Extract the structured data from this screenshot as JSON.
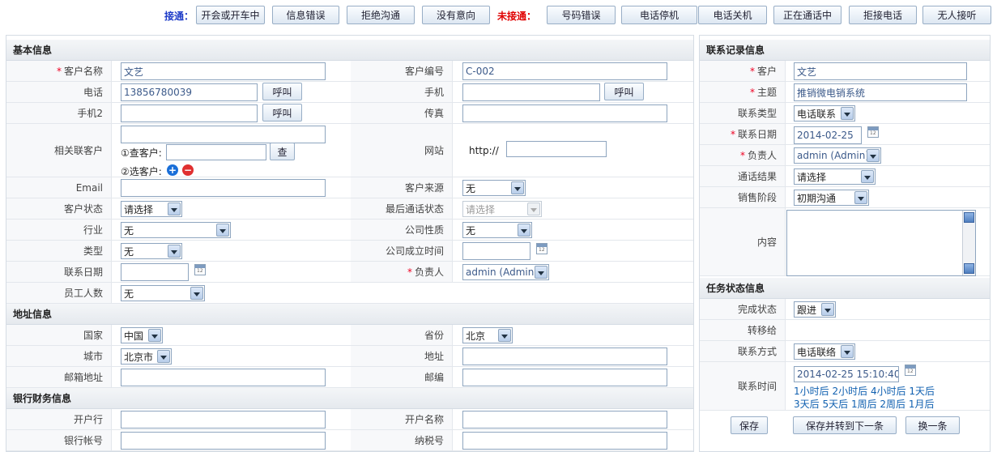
{
  "topbar": {
    "connected_label": "接通：",
    "connected_buttons": [
      "开会或开车中",
      "信息错误",
      "拒绝沟通",
      "没有意向"
    ],
    "not_connected_label": "未接通：",
    "not_connected_buttons": [
      "号码错误",
      "电话停机",
      "电话关机",
      "正在通话中",
      "拒接电话",
      "无人接听"
    ],
    "connected_color": "#1e3cc8",
    "not_connected_color": "#e00000"
  },
  "left": {
    "basic_title": "基本信息",
    "customer_name_label": "客户名称",
    "customer_name": "文艺",
    "customer_no_label": "客户编号",
    "customer_no": "C-002",
    "phone_label": "电话",
    "phone": "13856780039",
    "call_label": "呼叫",
    "mobile_label": "手机",
    "mobile2_label": "手机2",
    "fax_label": "传真",
    "related_label": "相关联客户",
    "find_label": "①查客户:",
    "find_btn": "查",
    "pick_label": "②选客户:",
    "website_label": "网站",
    "website_prefix": "http://",
    "email_label": "Email",
    "source_label": "客户来源",
    "source_value": "无",
    "status_label": "客户状态",
    "status_value": "请选择",
    "last_call_label": "最后通话状态",
    "last_call_value": "请选择",
    "industry_label": "行业",
    "industry_value": "无",
    "company_nature_label": "公司性质",
    "company_nature_value": "无",
    "type_label": "类型",
    "type_value": "无",
    "founded_label": "公司成立时间",
    "contact_date_label": "联系日期",
    "owner_label": "负责人",
    "owner_value": "admin (Admin)",
    "staff_label": "员工人数",
    "staff_value": "无",
    "address_title": "地址信息",
    "country_label": "国家",
    "country_value": "中国",
    "province_label": "省份",
    "province_value": "北京",
    "city_label": "城市",
    "city_value": "北京市",
    "address_label": "地址",
    "mail_address_label": "邮箱地址",
    "zip_label": "邮编",
    "bank_title": "银行财务信息",
    "bank_label": "开户行",
    "account_name_label": "开户名称",
    "bank_account_label": "银行帐号",
    "tax_no_label": "纳税号"
  },
  "right": {
    "record_title": "联系记录信息",
    "customer_label": "客户",
    "customer_value": "文艺",
    "subject_label": "主题",
    "subject_value": "推销微电销系统",
    "contact_type_label": "联系类型",
    "contact_type_value": "电话联系",
    "contact_date_label": "联系日期",
    "contact_date_value": "2014-02-25",
    "owner_label": "负责人",
    "owner_value": "admin (Admin)",
    "call_result_label": "通话结果",
    "call_result_value": "请选择",
    "stage_label": "销售阶段",
    "stage_value": "初期沟通",
    "content_label": "内容",
    "task_title": "任务状态信息",
    "finish_label": "完成状态",
    "finish_value": "跟进",
    "transfer_label": "转移给",
    "method_label": "联系方式",
    "method_value": "电话联络",
    "time_label": "联系时间",
    "time_value": "2014-02-25 15:10:40",
    "quick_times_1": [
      "1小时后",
      "2小时后",
      "4小时后",
      "1天后"
    ],
    "quick_times_2": [
      "3天后",
      "5天后",
      "1周后",
      "2周后",
      "1月后"
    ],
    "save_btn": "保存",
    "save_next_btn": "保存并转到下一条",
    "switch_btn": "换一条"
  }
}
